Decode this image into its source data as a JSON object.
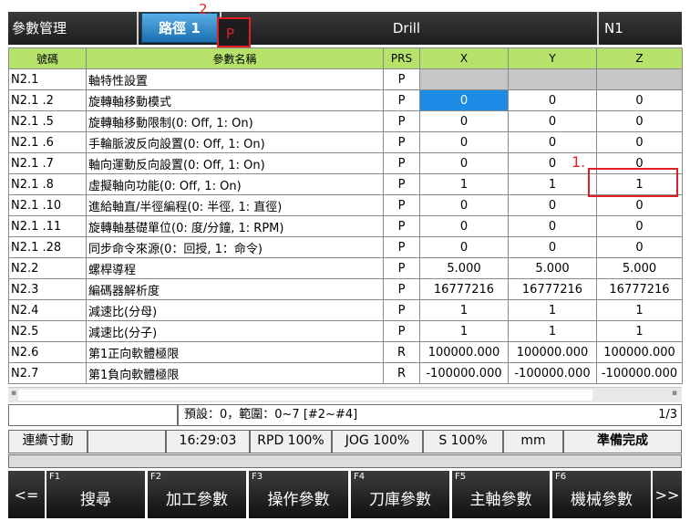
{
  "header": {
    "title": "參數管理",
    "path_tab": "路徑 1",
    "mode": "Drill",
    "channel": "N1",
    "annotation_marker": "2.",
    "annotation_label": "P"
  },
  "table": {
    "columns": [
      "號碼",
      "參數名稱",
      "PRS",
      "X",
      "Y",
      "Z"
    ],
    "rows": [
      [
        "N2.1",
        "軸特性設置",
        "P",
        "",
        "",
        ""
      ],
      [
        "N2.1 .2",
        "旋轉軸移動模式",
        "P",
        "0",
        "0",
        "0"
      ],
      [
        "N2.1 .5",
        "旋轉軸移動限制(0: Off, 1: On)",
        "P",
        "0",
        "0",
        "0"
      ],
      [
        "N2.1 .6",
        "手輪脈波反向設置(0: Off, 1: On)",
        "P",
        "0",
        "0",
        "0"
      ],
      [
        "N2.1 .7",
        "軸向運動反向設置(0: Off, 1: On)",
        "P",
        "0",
        "0",
        "0"
      ],
      [
        "N2.1 .8",
        "虛擬軸向功能(0: Off, 1: On)",
        "P",
        "1",
        "1",
        "1"
      ],
      [
        "N2.1 .10",
        "進給軸直/半徑編程(0: 半徑, 1: 直徑)",
        "P",
        "0",
        "0",
        "0"
      ],
      [
        "N2.1 .11",
        "旋轉軸基礎單位(0: 度/分鐘, 1: RPM)",
        "P",
        "0",
        "0",
        "0"
      ],
      [
        "N2.1 .28",
        "同步命令來源(0：回授, 1：命令)",
        "P",
        "0",
        "0",
        "0"
      ],
      [
        "N2.2",
        "螺桿導程",
        "P",
        "5.000",
        "5.000",
        "5.000"
      ],
      [
        "N2.3",
        "編碼器解析度",
        "P",
        "16777216",
        "16777216",
        "16777216"
      ],
      [
        "N2.4",
        "減速比(分母)",
        "P",
        "1",
        "1",
        "1"
      ],
      [
        "N2.5",
        "減速比(分子)",
        "P",
        "1",
        "1",
        "1"
      ],
      [
        "N2.6",
        "第1正向軟體極限",
        "R",
        "100000.000",
        "100000.000",
        "100000.000"
      ],
      [
        "N2.7",
        "第1負向軟體極限",
        "R",
        "-100000.000",
        "-100000.000",
        "-100000.000"
      ]
    ],
    "row1_annotation": "1."
  },
  "info": {
    "input_value": "",
    "hint": "預設：0，範圍：0~7 [#2~#4]",
    "page": "1/3"
  },
  "status": {
    "mode": "連續寸動",
    "time": "16:29:03",
    "rpd": "RPD 100%",
    "jog": "JOG 100%",
    "spindle": "S 100%",
    "unit": "mm",
    "state": "準備完成"
  },
  "fkeys": {
    "left": "<=",
    "right": ">>",
    "items": [
      {
        "num": "F1",
        "label": "搜尋"
      },
      {
        "num": "F2",
        "label": "加工參數"
      },
      {
        "num": "F3",
        "label": "操作參數"
      },
      {
        "num": "F4",
        "label": "刀庫參數"
      },
      {
        "num": "F5",
        "label": "主軸參數"
      },
      {
        "num": "F6",
        "label": "機械參數"
      }
    ]
  },
  "colors": {
    "header_green": "#b6e26b",
    "selected_blue": "#1d8ae6",
    "annotation_red": "#e21f26"
  }
}
